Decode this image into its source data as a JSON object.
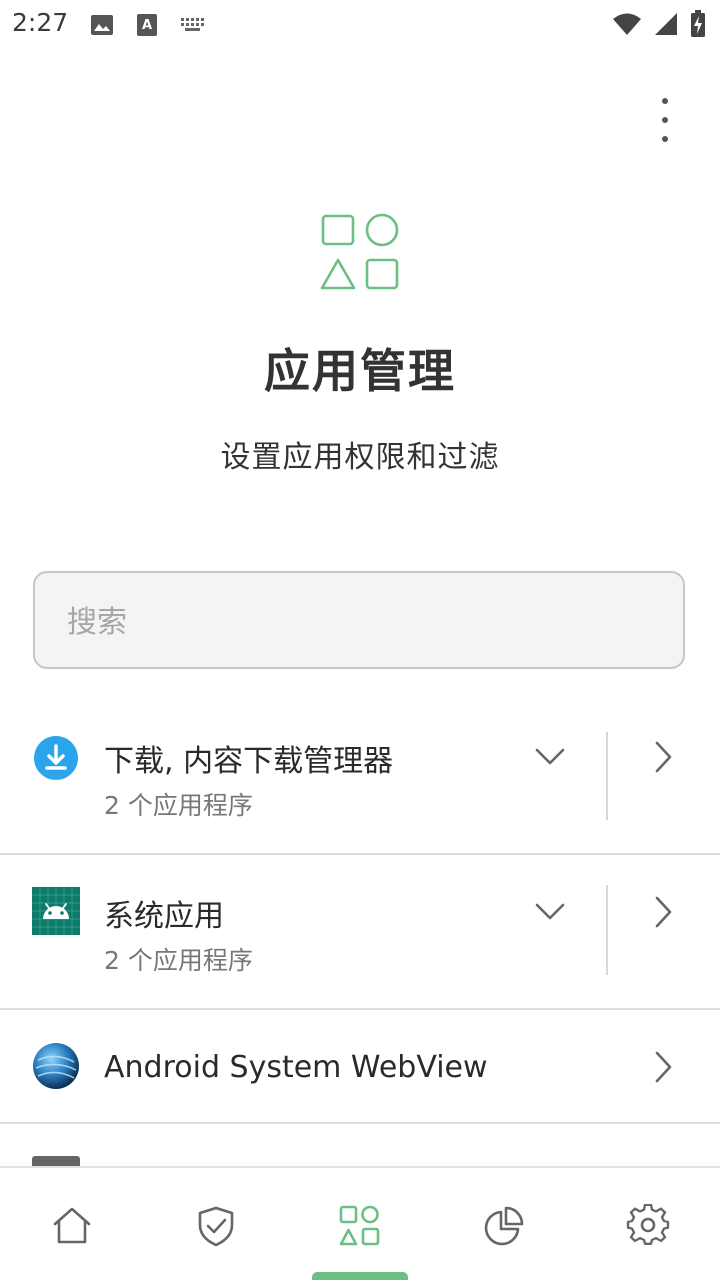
{
  "status_bar": {
    "time": "2:27",
    "left_icons": [
      "image-icon",
      "text-a-icon",
      "keyboard-icon"
    ],
    "right_icons": [
      "wifi-icon",
      "signal-icon",
      "battery-charging-icon"
    ]
  },
  "header": {
    "title": "应用管理",
    "subtitle": "设置应用权限和过滤",
    "icon": "apps-shapes-icon",
    "accent_color": "#6bbf82"
  },
  "search": {
    "placeholder": "搜索",
    "value": ""
  },
  "list": [
    {
      "title": "下载, 内容下载管理器",
      "subtitle": "2 个应用程序",
      "icon": "download-icon",
      "expandable": true
    },
    {
      "title": "系统应用",
      "subtitle": "2 个应用程序",
      "icon": "android-icon",
      "expandable": true
    },
    {
      "title": "Android System WebView",
      "subtitle": "",
      "icon": "webview-globe-icon",
      "expandable": false
    }
  ],
  "bottom_nav": {
    "items": [
      "home-icon",
      "shield-check-icon",
      "apps-icon",
      "pie-chart-icon",
      "settings-gear-icon"
    ],
    "active_index": 2
  }
}
